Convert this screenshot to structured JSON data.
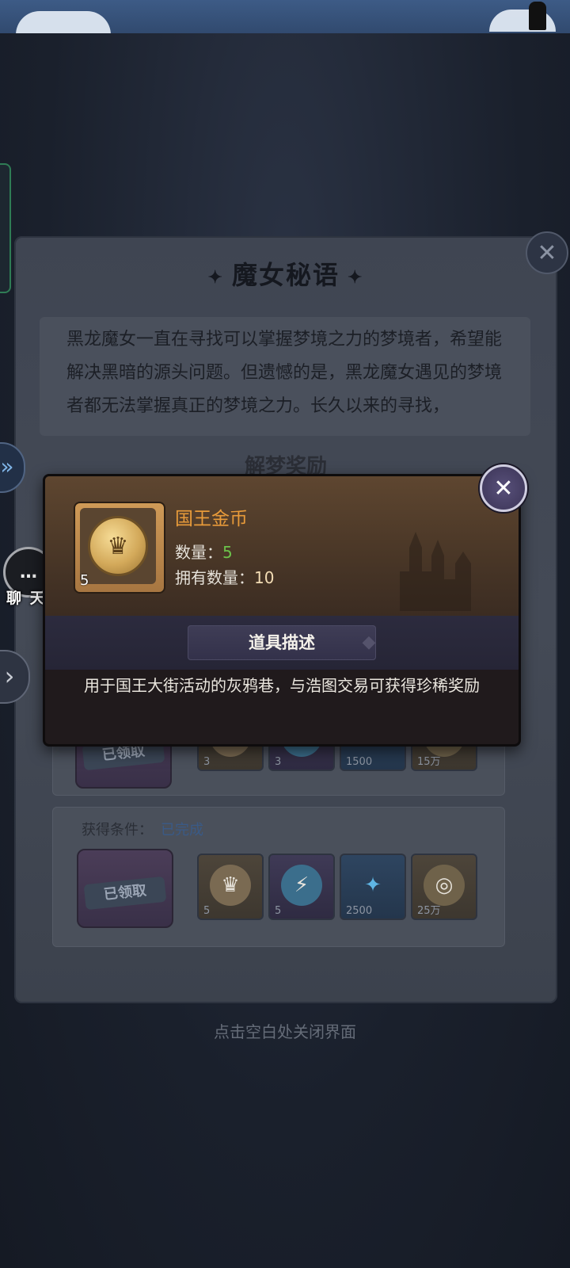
{
  "panel": {
    "title": "魔女秘语",
    "story": "黑龙魔女一直在寻找可以掌握梦境之力的梦境者，希望能解决黑暗的源头问题。但遗憾的是，黑龙魔女遇见的梦境者都无法掌握真正的梦境之力。长久以来的寻找，",
    "section_title": "解梦奖励",
    "rows": [
      {
        "chest_label": "已领取",
        "items": [
          {
            "qty": "3",
            "icon": "king-coin-icon"
          },
          {
            "qty": "3",
            "icon": "energy-icon"
          },
          {
            "qty": "1500",
            "icon": "crystal-icon"
          },
          {
            "qty": "15万",
            "icon": "gold-coin-icon"
          }
        ]
      },
      {
        "condition_label": "获得条件：",
        "condition_value": "已完成",
        "chest_label": "已领取",
        "items": [
          {
            "qty": "5",
            "icon": "king-coin-icon"
          },
          {
            "qty": "5",
            "icon": "energy-icon"
          },
          {
            "qty": "2500",
            "icon": "crystal-icon"
          },
          {
            "qty": "25万",
            "icon": "gold-coin-icon"
          }
        ]
      }
    ]
  },
  "close_hint": "点击空白处关闭界面",
  "sidebar": {
    "chat_label": "聊 天"
  },
  "popup": {
    "item_name": "国王金币",
    "item_badge_qty": "5",
    "qty_label": "数量：",
    "qty_value": "5",
    "owned_label": "拥有数量：",
    "owned_value": "10",
    "desc_title": "道具描述",
    "description": "用于国王大街活动的灰鸦巷，与浩图交易可获得珍稀奖励"
  },
  "colors": {
    "item_name": "#e89b3a",
    "qty_value": "#6cc24a",
    "condition_value": "#3a5a86"
  }
}
